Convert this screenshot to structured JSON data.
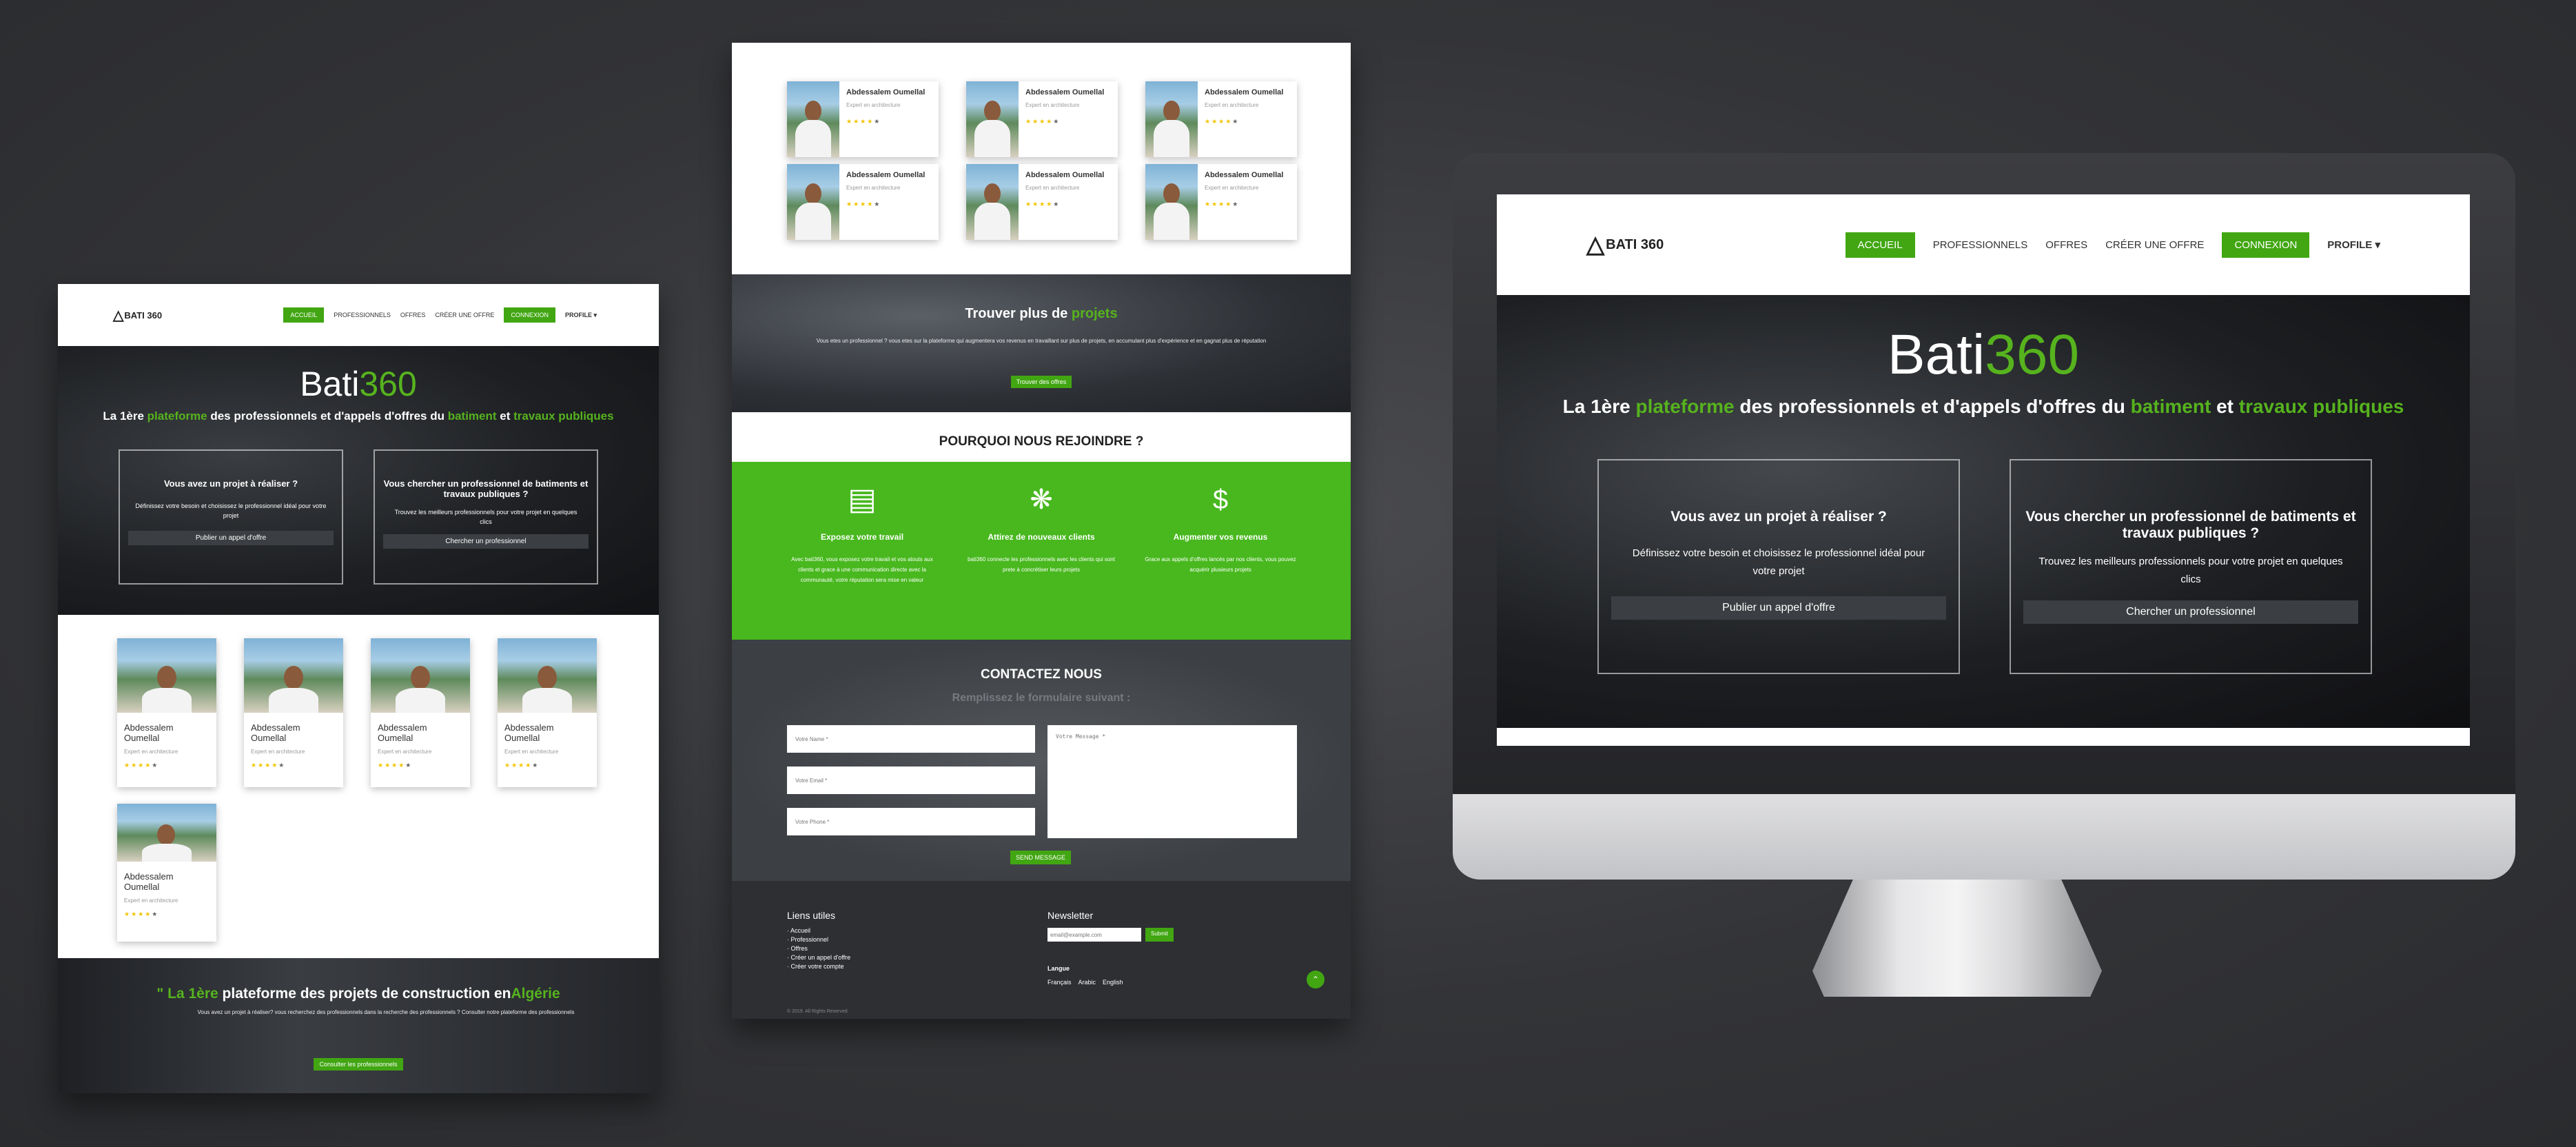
{
  "brand": {
    "logo_text": "BATI 360",
    "icon": "triangle-logo-icon",
    "colors": {
      "green": "#41a612",
      "dark": "#1f2125",
      "footer": "#2e3034"
    }
  },
  "nav": {
    "items": [
      "ACCUEIL",
      "PROFESSIONNELS",
      "OFFRES",
      "CRÉER UNE OFFRE"
    ],
    "connexion": "CONNEXION",
    "profile": "PROFILE"
  },
  "hero": {
    "title_a": "Bati",
    "title_b": "360",
    "sub_1": "La 1ère ",
    "sub_2": "plateforme",
    "sub_3": " des professionnels et d'appels d'offres du ",
    "sub_4": "batiment",
    "sub_5": " et ",
    "sub_6": "travaux publiques",
    "box1": {
      "title": "Vous avez un projet à réaliser ?",
      "text": "Définissez votre besoin et choisissez le professionnel idéal pour votre projet",
      "button": "Publier un appel d'offre"
    },
    "box2": {
      "title": "Vous chercher un professionnel de batiments et travaux publiques ?",
      "text": "Trouvez les meilleurs professionnels pour votre projet en quelques clics",
      "button": "Chercher un professionnel"
    }
  },
  "pro": {
    "name": "Abdessalem Oumellal",
    "role": "Expert en architecture",
    "stars": "★★★★",
    "star_off": "★"
  },
  "banner1": {
    "title_1": "\" La 1ère ",
    "title_2": "plateforme des projets de construction en",
    "title_3": "Algérie",
    "text": "Vous avez un projet à réaliser? vous recherchez des professionnels dans la recherche des professionnels ? Consulter notre plateforme des professionnels",
    "button": "Consulter les professionnels"
  },
  "more": {
    "title_1": "Trouver plus de ",
    "title_2": "projets",
    "text": "Vous etes un professionnel ? vous etes sur la plateforme qui augmentera vos revenus en travaillant sur plus de projets, en accumulant plus d'expérience et en gagnat plus de réputation",
    "button": "Trouver des offres"
  },
  "why": {
    "title": "POURQUOI NOUS REJOINDRE ?",
    "items": [
      {
        "icon": "billboard-icon",
        "title": "Exposez votre travail",
        "text": "Avec bati360, vous exposez votre travail et vos atouts aux clients et grace à une communication directe avec la communauté, votre réputation sera mise en valeur"
      },
      {
        "icon": "handshake-icon",
        "title": "Attirez de nouveaux clients",
        "text": "bati360 connecte les professionnels avec les clients qui sont prete à concrétiser leurs projets"
      },
      {
        "icon": "money-hand-icon",
        "title": "Augmenter vos revenus",
        "text": "Grace aux appels d'offres lancés par nos clients, vous pouvez acquérir plusieurs projets"
      }
    ]
  },
  "contact": {
    "title": "CONTACTEZ NOUS",
    "subtitle": "Remplissez le formulaire suivant :",
    "name_ph": "Votre Name *",
    "email_ph": "Votre Email *",
    "phone_ph": "Votre Phone *",
    "message_ph": "Votre Message *",
    "button": "SEND MESSAGE"
  },
  "footer": {
    "links_title": "Liens utiles",
    "links": [
      "Accueil",
      "Professionnel",
      "Offres",
      "Créer un appel d'offre",
      "Créer votre compte"
    ],
    "news_title": "Newsletter",
    "news_ph": "email@example.com",
    "news_btn": "Submit",
    "lang_title": "Langue",
    "langs": [
      "Français",
      "Arabic",
      "English"
    ],
    "copyright": "© 2019. All Rights Reserved."
  }
}
